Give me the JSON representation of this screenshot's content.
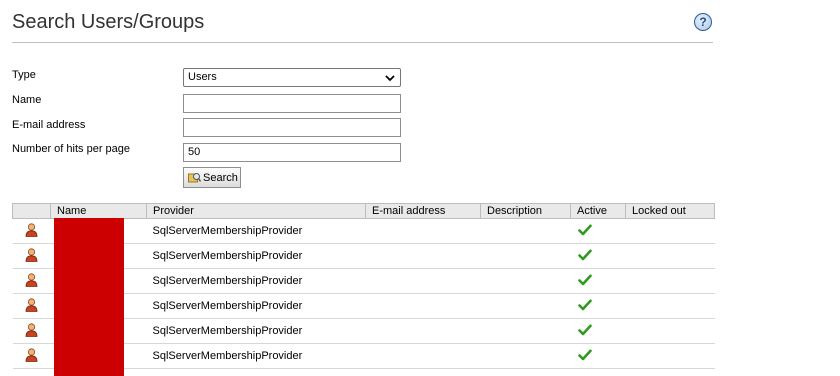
{
  "page": {
    "title": "Search Users/Groups",
    "help_glyph": "?",
    "help_icon": "help-icon"
  },
  "form": {
    "type_label": "Type",
    "type_value": "Users",
    "name_label": "Name",
    "name_value": "",
    "email_label": "E-mail address",
    "email_value": "",
    "hits_label": "Number of hits per page",
    "hits_value": "50",
    "search_label": "Search"
  },
  "table": {
    "columns": [
      "",
      "Name",
      "Provider",
      "E-mail address",
      "Description",
      "Active",
      "Locked out"
    ],
    "rows": [
      {
        "name": "",
        "provider": "SqlServerMembershipProvider",
        "email": "",
        "description": "",
        "active": true,
        "locked_out": ""
      },
      {
        "name": "",
        "provider": "SqlServerMembershipProvider",
        "email": "",
        "description": "",
        "active": true,
        "locked_out": ""
      },
      {
        "name": "",
        "provider": "SqlServerMembershipProvider",
        "email": "",
        "description": "",
        "active": true,
        "locked_out": ""
      },
      {
        "name": "",
        "provider": "SqlServerMembershipProvider",
        "email": "",
        "description": "",
        "active": true,
        "locked_out": ""
      },
      {
        "name": "",
        "provider": "SqlServerMembershipProvider",
        "email": "",
        "description": "",
        "active": true,
        "locked_out": ""
      },
      {
        "name": "",
        "provider": "SqlServerMembershipProvider",
        "email": "",
        "description": "",
        "active": true,
        "locked_out": ""
      }
    ]
  },
  "colors": {
    "redaction": "#cc0000",
    "check": "#2e9b1e",
    "header_bg": "#e9e9e9"
  },
  "icons": {
    "row_icon": "user-icon",
    "active_icon": "checkmark-icon",
    "search_icon": "search-icon"
  }
}
